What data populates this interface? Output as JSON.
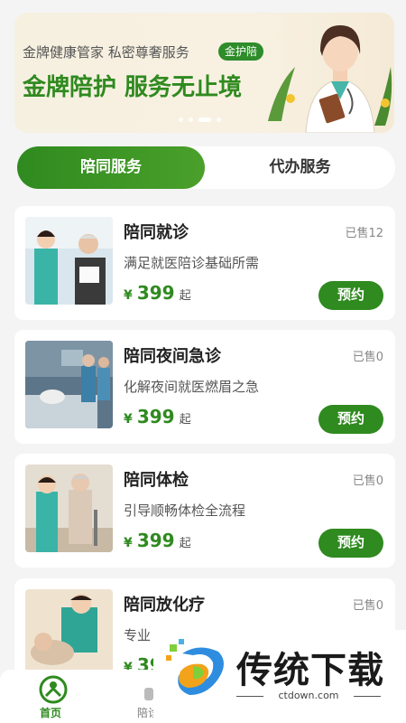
{
  "banner": {
    "subtitle": "金牌健康管家 私密尊奢服务",
    "badge": "金护陪",
    "title": "金牌陪护 服务无止境"
  },
  "tabs": [
    {
      "label": "陪同服务",
      "active": true
    },
    {
      "label": "代办服务",
      "active": false
    }
  ],
  "services": [
    {
      "name": "陪同就诊",
      "sold": "已售12",
      "desc": "满足就医陪诊基础所需",
      "currency": "¥",
      "price": "399",
      "suffix": "起",
      "button": "预约"
    },
    {
      "name": "陪同夜间急诊",
      "sold": "已售0",
      "desc": "化解夜间就医燃眉之急",
      "currency": "¥",
      "price": "399",
      "suffix": "起",
      "button": "预约"
    },
    {
      "name": "陪同体检",
      "sold": "已售0",
      "desc": "引导顺畅体检全流程",
      "currency": "¥",
      "price": "399",
      "suffix": "起",
      "button": "预约"
    },
    {
      "name": "陪同放化疗",
      "sold": "已售0",
      "desc": "专业",
      "currency": "¥",
      "price": "39",
      "suffix": "",
      "button": ""
    }
  ],
  "bottom_nav": [
    {
      "label": "首页",
      "icon": "home-icon",
      "active": true
    },
    {
      "label": "陪诊",
      "icon": "nurse-icon",
      "active": false
    }
  ],
  "watermark": {
    "text": "传统下载",
    "url": "ctdown.com"
  },
  "colors": {
    "brand_green": "#2f8a1f",
    "background": "#f4f4f4"
  }
}
